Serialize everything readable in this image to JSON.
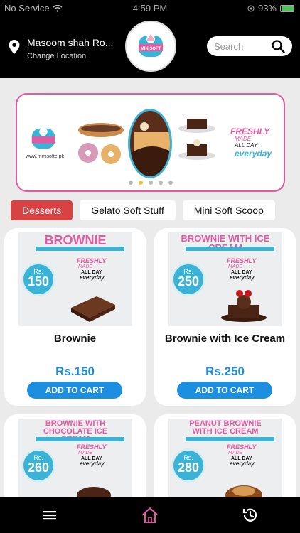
{
  "status_bar": {
    "carrier": "No Service",
    "time": "4:59 PM",
    "battery": "93%",
    "battery_level": 0.93
  },
  "header": {
    "location_name": "Masoom shah Ro...",
    "change_location": "Change Location",
    "logo_text": "MINI SOFT CHILL BAR",
    "search_placeholder": "Search"
  },
  "banner": {
    "website": "www.minisofte.pk",
    "tag_line1": "FRESHLY",
    "tag_line2": "MADE",
    "tag_line3": "ALL DAY",
    "tag_line4": "everyday",
    "slides_count": 5,
    "active_slide": 1
  },
  "categories": [
    {
      "label": "Desserts",
      "active": true
    },
    {
      "label": "Gelato Soft Stuff",
      "active": false
    },
    {
      "label": "Mini Soft Scoop",
      "active": false
    }
  ],
  "products": [
    {
      "image_title": "BROWNIE",
      "image_price": "150",
      "rs": "Rs.",
      "name": "Brownie",
      "price": "Rs.150",
      "button": "ADD TO CART"
    },
    {
      "image_title": "BROWNIE WITH ICE CREAM",
      "image_price": "250",
      "rs": "Rs.",
      "name": "Brownie with Ice Cream",
      "price": "Rs.250",
      "button": "ADD TO CART"
    },
    {
      "image_title": "BROWNIE WITH CHOCOLATE ICE CREAM",
      "image_price": "260",
      "rs": "Rs.",
      "name": "",
      "price": "",
      "button": ""
    },
    {
      "image_title": "PEANUT BROWNIE WITH ICE CREAM",
      "image_price": "280",
      "rs": "Rs.",
      "name": "",
      "price": "",
      "button": ""
    }
  ],
  "fresh_label": {
    "f1": "FRESHLY",
    "f2": "MADE",
    "f3": "ALL DAY",
    "f4": "everyday"
  },
  "colors": {
    "accent_pink": "#e35aa1",
    "accent_blue": "#3ab3d6",
    "button_blue": "#1d8fe0",
    "tab_active": "#d84243"
  },
  "bottom_nav": [
    {
      "icon": "menu-icon"
    },
    {
      "icon": "home-icon",
      "active": true
    },
    {
      "icon": "history-icon"
    }
  ]
}
